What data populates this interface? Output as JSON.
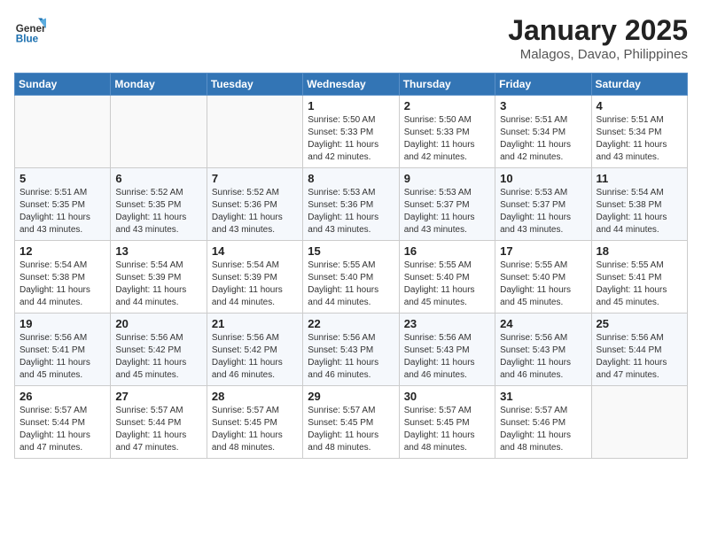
{
  "header": {
    "logo_general": "General",
    "logo_blue": "Blue",
    "month": "January 2025",
    "location": "Malagos, Davao, Philippines"
  },
  "weekdays": [
    "Sunday",
    "Monday",
    "Tuesday",
    "Wednesday",
    "Thursday",
    "Friday",
    "Saturday"
  ],
  "weeks": [
    [
      {
        "day": "",
        "info": ""
      },
      {
        "day": "",
        "info": ""
      },
      {
        "day": "",
        "info": ""
      },
      {
        "day": "1",
        "info": "Sunrise: 5:50 AM\nSunset: 5:33 PM\nDaylight: 11 hours\nand 42 minutes."
      },
      {
        "day": "2",
        "info": "Sunrise: 5:50 AM\nSunset: 5:33 PM\nDaylight: 11 hours\nand 42 minutes."
      },
      {
        "day": "3",
        "info": "Sunrise: 5:51 AM\nSunset: 5:34 PM\nDaylight: 11 hours\nand 42 minutes."
      },
      {
        "day": "4",
        "info": "Sunrise: 5:51 AM\nSunset: 5:34 PM\nDaylight: 11 hours\nand 43 minutes."
      }
    ],
    [
      {
        "day": "5",
        "info": "Sunrise: 5:51 AM\nSunset: 5:35 PM\nDaylight: 11 hours\nand 43 minutes."
      },
      {
        "day": "6",
        "info": "Sunrise: 5:52 AM\nSunset: 5:35 PM\nDaylight: 11 hours\nand 43 minutes."
      },
      {
        "day": "7",
        "info": "Sunrise: 5:52 AM\nSunset: 5:36 PM\nDaylight: 11 hours\nand 43 minutes."
      },
      {
        "day": "8",
        "info": "Sunrise: 5:53 AM\nSunset: 5:36 PM\nDaylight: 11 hours\nand 43 minutes."
      },
      {
        "day": "9",
        "info": "Sunrise: 5:53 AM\nSunset: 5:37 PM\nDaylight: 11 hours\nand 43 minutes."
      },
      {
        "day": "10",
        "info": "Sunrise: 5:53 AM\nSunset: 5:37 PM\nDaylight: 11 hours\nand 43 minutes."
      },
      {
        "day": "11",
        "info": "Sunrise: 5:54 AM\nSunset: 5:38 PM\nDaylight: 11 hours\nand 44 minutes."
      }
    ],
    [
      {
        "day": "12",
        "info": "Sunrise: 5:54 AM\nSunset: 5:38 PM\nDaylight: 11 hours\nand 44 minutes."
      },
      {
        "day": "13",
        "info": "Sunrise: 5:54 AM\nSunset: 5:39 PM\nDaylight: 11 hours\nand 44 minutes."
      },
      {
        "day": "14",
        "info": "Sunrise: 5:54 AM\nSunset: 5:39 PM\nDaylight: 11 hours\nand 44 minutes."
      },
      {
        "day": "15",
        "info": "Sunrise: 5:55 AM\nSunset: 5:40 PM\nDaylight: 11 hours\nand 44 minutes."
      },
      {
        "day": "16",
        "info": "Sunrise: 5:55 AM\nSunset: 5:40 PM\nDaylight: 11 hours\nand 45 minutes."
      },
      {
        "day": "17",
        "info": "Sunrise: 5:55 AM\nSunset: 5:40 PM\nDaylight: 11 hours\nand 45 minutes."
      },
      {
        "day": "18",
        "info": "Sunrise: 5:55 AM\nSunset: 5:41 PM\nDaylight: 11 hours\nand 45 minutes."
      }
    ],
    [
      {
        "day": "19",
        "info": "Sunrise: 5:56 AM\nSunset: 5:41 PM\nDaylight: 11 hours\nand 45 minutes."
      },
      {
        "day": "20",
        "info": "Sunrise: 5:56 AM\nSunset: 5:42 PM\nDaylight: 11 hours\nand 45 minutes."
      },
      {
        "day": "21",
        "info": "Sunrise: 5:56 AM\nSunset: 5:42 PM\nDaylight: 11 hours\nand 46 minutes."
      },
      {
        "day": "22",
        "info": "Sunrise: 5:56 AM\nSunset: 5:43 PM\nDaylight: 11 hours\nand 46 minutes."
      },
      {
        "day": "23",
        "info": "Sunrise: 5:56 AM\nSunset: 5:43 PM\nDaylight: 11 hours\nand 46 minutes."
      },
      {
        "day": "24",
        "info": "Sunrise: 5:56 AM\nSunset: 5:43 PM\nDaylight: 11 hours\nand 46 minutes."
      },
      {
        "day": "25",
        "info": "Sunrise: 5:56 AM\nSunset: 5:44 PM\nDaylight: 11 hours\nand 47 minutes."
      }
    ],
    [
      {
        "day": "26",
        "info": "Sunrise: 5:57 AM\nSunset: 5:44 PM\nDaylight: 11 hours\nand 47 minutes."
      },
      {
        "day": "27",
        "info": "Sunrise: 5:57 AM\nSunset: 5:44 PM\nDaylight: 11 hours\nand 47 minutes."
      },
      {
        "day": "28",
        "info": "Sunrise: 5:57 AM\nSunset: 5:45 PM\nDaylight: 11 hours\nand 48 minutes."
      },
      {
        "day": "29",
        "info": "Sunrise: 5:57 AM\nSunset: 5:45 PM\nDaylight: 11 hours\nand 48 minutes."
      },
      {
        "day": "30",
        "info": "Sunrise: 5:57 AM\nSunset: 5:45 PM\nDaylight: 11 hours\nand 48 minutes."
      },
      {
        "day": "31",
        "info": "Sunrise: 5:57 AM\nSunset: 5:46 PM\nDaylight: 11 hours\nand 48 minutes."
      },
      {
        "day": "",
        "info": ""
      }
    ]
  ]
}
